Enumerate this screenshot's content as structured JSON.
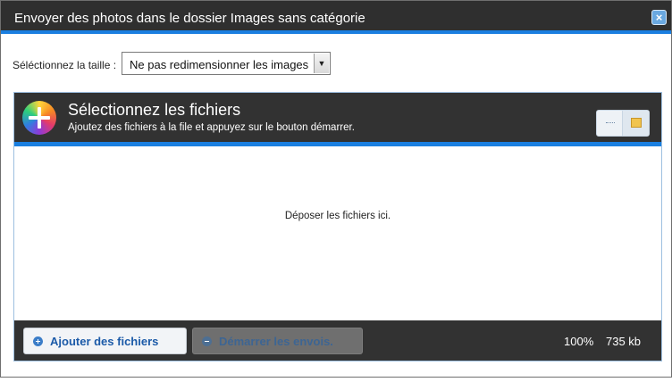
{
  "dialog": {
    "title": "Envoyer des photos dans le dossier Images sans catégorie",
    "close_label": "×"
  },
  "resize": {
    "label": "Séléctionnez la taille :",
    "selected_option": "Ne pas redimensionner les images",
    "arrow": "▼"
  },
  "uploader": {
    "header": {
      "title": "Sélectionnez les fichiers",
      "subtitle": "Ajoutez des fichiers à la file et appuyez sur le bouton démarrer."
    },
    "view_toggle": {
      "list_icon": "list-view-icon",
      "thumbs_icon": "thumbnail-view-icon",
      "active": "thumbnails"
    },
    "dropzone_text": "Déposer les fichiers ici.",
    "footer": {
      "add_button": "Ajouter des fichiers",
      "start_button": "Démarrer les envois.",
      "progress": "100%",
      "total_size": "735 kb"
    }
  },
  "colors": {
    "titlebar_bg": "#2f2f2f",
    "accent_blue": "#1a7fe0",
    "panel_bg": "#323232"
  }
}
